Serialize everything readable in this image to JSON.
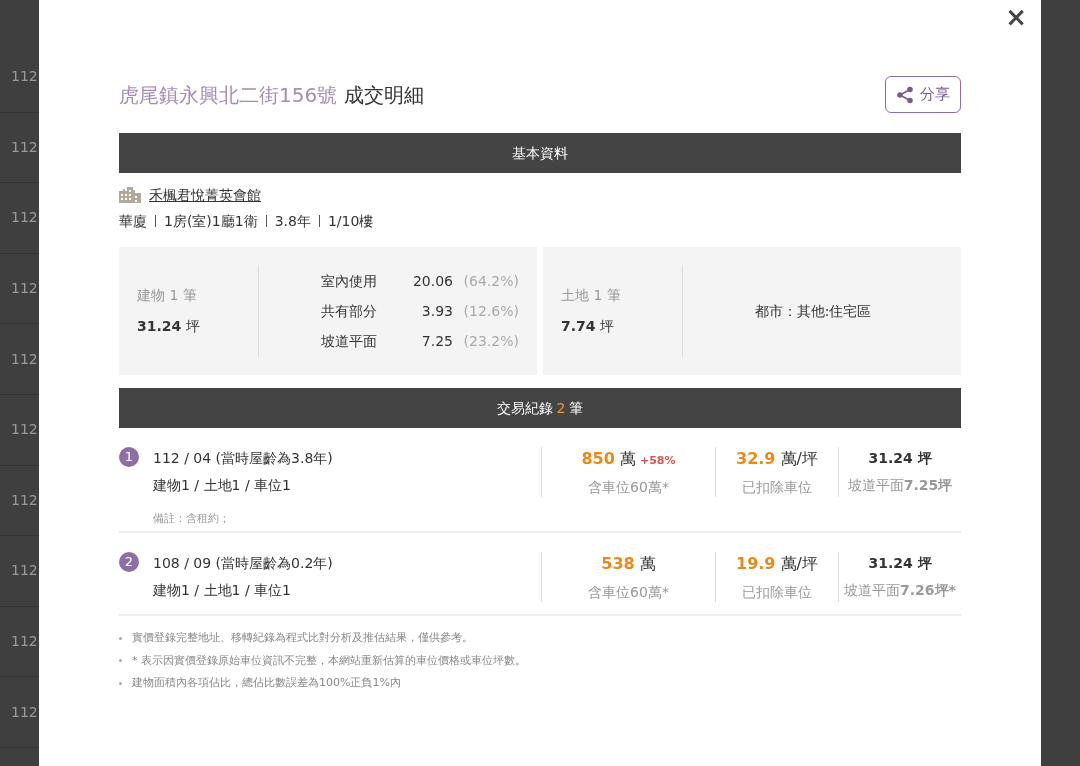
{
  "background_list": {
    "rows": [
      "112",
      "112",
      "112",
      "112",
      "112",
      "112",
      "112",
      "112",
      "112",
      "112"
    ]
  },
  "dialog": {
    "close": "×",
    "title": {
      "address": "虎尾鎮永興北二街156號",
      "suffix": "成交明細"
    },
    "share_button": "分享",
    "basic_header": "基本資料",
    "community": "禾楓君悅菁英會館",
    "attributes": [
      "華廈",
      "1房(室)1廳1衛",
      "3.8年",
      "1/10樓"
    ],
    "building": {
      "label": "建物 1 筆",
      "area": "31.24",
      "unit": "坪",
      "breakdown": [
        {
          "label": "室內使用",
          "value": "20.06",
          "share": "(64.2%)"
        },
        {
          "label": "共有部分",
          "value": "3.93",
          "share": "(12.6%)"
        },
        {
          "label": "坡道平面",
          "value": "7.25",
          "share": "(23.2%)"
        }
      ]
    },
    "land": {
      "label": "土地 1 筆",
      "area": "7.74",
      "unit": "坪",
      "zoning": "都市：其他:住宅區"
    },
    "transactions_header": {
      "prefix": "交易紀錄",
      "count": "2",
      "suffix": "筆"
    },
    "transactions": [
      {
        "index": "1",
        "date": "112 / 04 (當時屋齡為3.8年)",
        "parts": "建物1 / 土地1 / 車位1",
        "price": "850",
        "price_unit": "萬",
        "change": "+58%",
        "price_note": "含車位60萬*",
        "unit_price": "32.9",
        "unit_price_unit": "萬/坪",
        "unit_price_note": "已扣除車位",
        "area": "31.24 坪",
        "area_note_label": "坡道平面",
        "area_note_value": "7.25坪",
        "remark": "備註：含租約；"
      },
      {
        "index": "2",
        "date": "108 / 09 (當時屋齡為0.2年)",
        "parts": "建物1 / 土地1 / 車位1",
        "price": "538",
        "price_unit": "萬",
        "price_note": "含車位60萬*",
        "unit_price": "19.9",
        "unit_price_unit": "萬/坪",
        "unit_price_note": "已扣除車位",
        "area": "31.24 坪",
        "area_note_label": "坡道平面",
        "area_note_value": "7.26坪*"
      }
    ],
    "notes": [
      "實價登錄完整地址、移轉紀錄為程式比對分析及推估結果，僅供參考。",
      "* 表示因實價登錄原始車位資訊不完整，本網站重新估算的車位價格或車位坪數。",
      "建物面積內各項佔比，總佔比數誤差為100%正負1%內"
    ]
  }
}
